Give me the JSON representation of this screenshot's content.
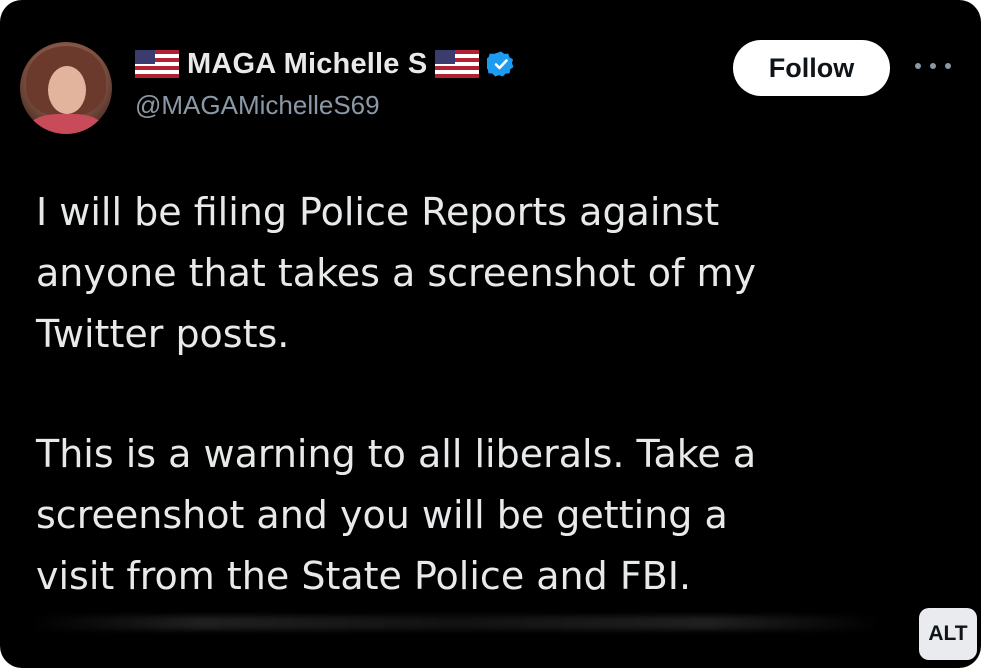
{
  "tweet": {
    "author": {
      "display_name": "MAGA Michelle S",
      "handle": "@MAGAMichelleS69",
      "verified": true,
      "avatar_icon": "avatar-photo",
      "flag_icon": "us-flag-emoji"
    },
    "follow_label": "Follow",
    "more_icon": "more-options-icon",
    "paragraphs": [
      {
        "lines": [
          "I will be filing Police Reports against",
          "anyone that takes a screenshot of my",
          "Twitter posts."
        ]
      },
      {
        "lines": [
          "This is a warning to all liberals. Take a",
          "screenshot and you will be getting a",
          "visit from the State Police and FBI."
        ]
      }
    ]
  },
  "alt_badge": "ALT",
  "colors": {
    "background": "#000000",
    "text": "#e7e9ea",
    "secondary_text": "#8b98a5",
    "verified_blue": "#1d9bf0",
    "follow_bg": "#ffffff"
  }
}
